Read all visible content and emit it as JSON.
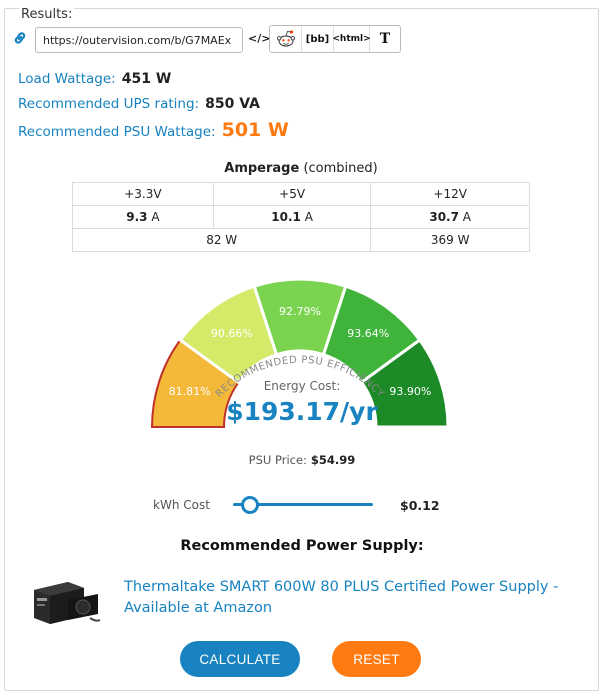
{
  "legend": "Results:",
  "share": {
    "url": "https://outervision.com/b/G7MAEx",
    "embed_label": "</>",
    "bb_label": "[bb]",
    "html_label": "<html>",
    "text_label": "T"
  },
  "summary": {
    "load_label": "Load Wattage:",
    "load_value": "451 W",
    "ups_label": "Recommended UPS rating:",
    "ups_value": "850 VA",
    "psu_label": "Recommended PSU Wattage:",
    "psu_value": "501 W"
  },
  "amperage": {
    "title": "Amperage",
    "subtitle": "(combined)",
    "headers": [
      "+3.3V",
      "+5V",
      "+12V"
    ],
    "amps": [
      "9.3",
      "10.1",
      "30.7"
    ],
    "amp_unit": "A",
    "watts_combined": "82 W",
    "watts_12v": "369 W"
  },
  "gauge": {
    "arc_title": "RECOMMENDED PSU EFFICIENCY",
    "segments": [
      {
        "label": "81.81%",
        "color": "#f5b93a",
        "selected": true
      },
      {
        "label": "90.66%",
        "color": "#d6ea6a",
        "selected": false
      },
      {
        "label": "92.79%",
        "color": "#7ad44f",
        "selected": false
      },
      {
        "label": "93.64%",
        "color": "#3fb33a",
        "selected": false
      },
      {
        "label": "93.90%",
        "color": "#1c8a26",
        "selected": false
      }
    ],
    "energy_label": "Energy Cost:",
    "energy_value": "$193.17/yr"
  },
  "psu_price": {
    "label": "PSU Price:",
    "value": "$54.99"
  },
  "kwh": {
    "label": "kWh Cost",
    "value": "$0.12",
    "slider_fraction": 0.12
  },
  "recommended": {
    "title": "Recommended Power Supply:",
    "link_text": "Thermaltake SMART 600W 80 PLUS Certified Power Supply - Available at Amazon"
  },
  "buttons": {
    "calculate": "CALCULATE",
    "reset": "RESET"
  },
  "colors": {
    "accent": "#1883c0",
    "orange": "#ff7a11"
  }
}
